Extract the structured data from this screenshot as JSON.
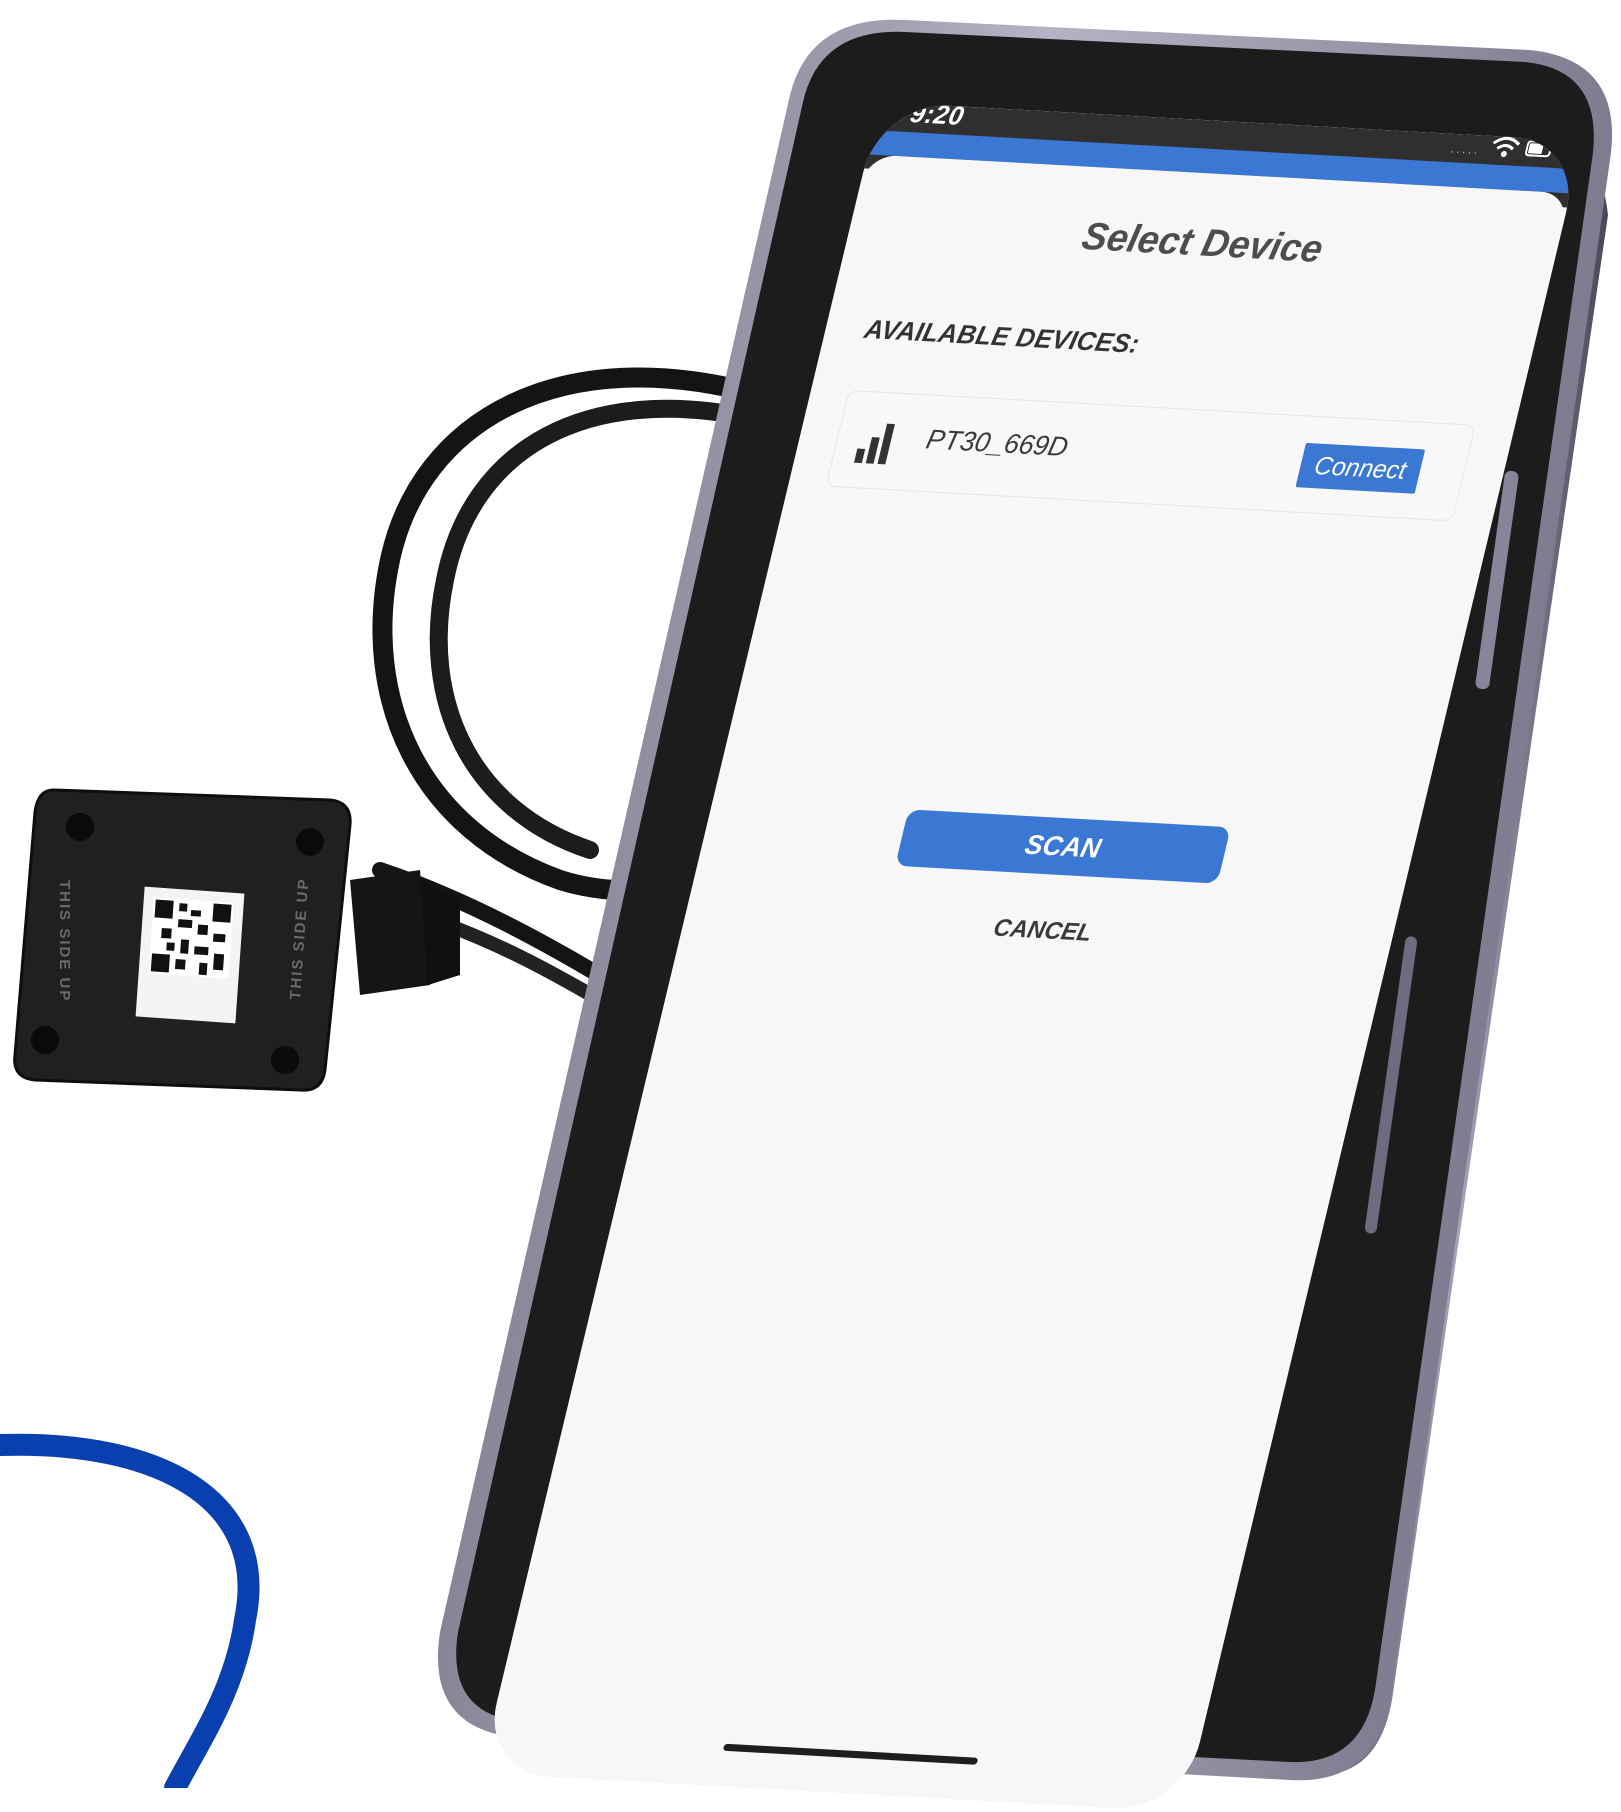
{
  "status_bar": {
    "time": "9:20",
    "signal_dots": "·····",
    "wifi_icon": "wifi-icon",
    "battery_icon": "battery-icon"
  },
  "dialog": {
    "title": "Select Device",
    "section_title": "AVAILABLE DEVICES:",
    "devices": [
      {
        "name": "PT30_669D",
        "action_label": "Connect",
        "signal_icon": "signal-strength-icon"
      }
    ],
    "scan_label": "SCAN",
    "cancel_label": "CANCEL"
  },
  "sensor": {
    "side_label": "THIS SIDE UP"
  },
  "colors": {
    "accent": "#3a78d4",
    "phone_frame": "#9a94aa",
    "bezel": "#1c1c1c",
    "decor_curve": "#0a3fb0"
  }
}
